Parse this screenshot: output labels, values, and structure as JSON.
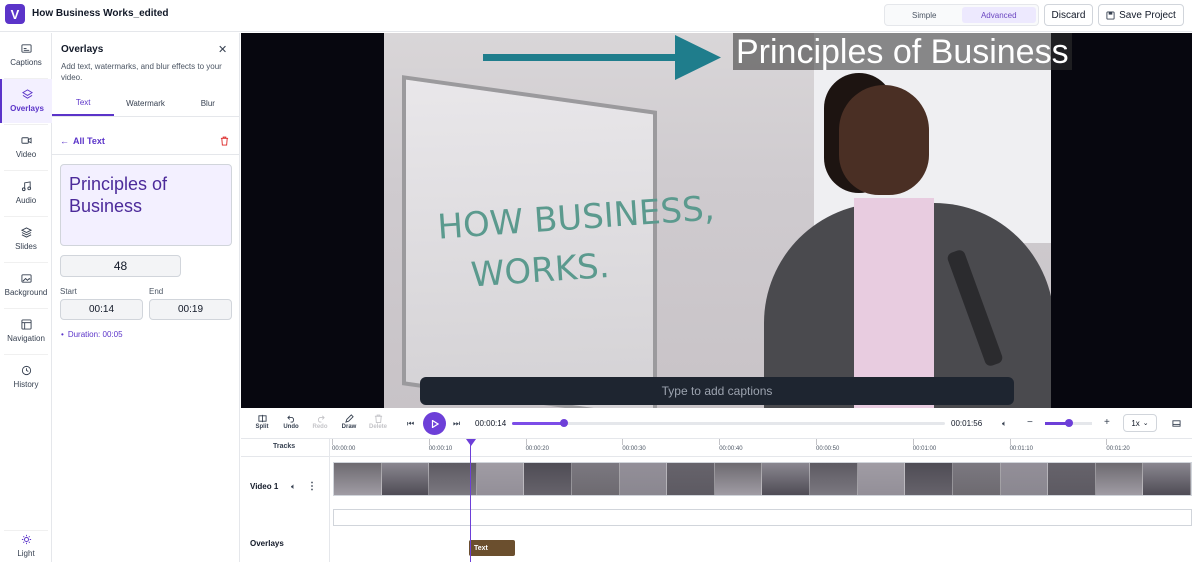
{
  "app": {
    "logo_letter": "V",
    "project_title": "How Business Works_edited",
    "mode_simple": "Simple",
    "mode_advanced": "Advanced",
    "discard_label": "Discard",
    "save_label": "Save Project"
  },
  "rail": {
    "items": [
      {
        "label": "Captions",
        "icon": "captions-icon"
      },
      {
        "label": "Overlays",
        "icon": "layers-icon"
      },
      {
        "label": "Video",
        "icon": "video-camera-icon"
      },
      {
        "label": "Audio",
        "icon": "music-note-icon"
      },
      {
        "label": "Slides",
        "icon": "stack-icon"
      },
      {
        "label": "Background",
        "icon": "image-icon"
      },
      {
        "label": "Navigation",
        "icon": "layout-icon"
      },
      {
        "label": "History",
        "icon": "history-icon"
      }
    ],
    "theme_label": "Light"
  },
  "panel": {
    "title": "Overlays",
    "description": "Add text, watermarks, and blur effects to your video.",
    "tabs": [
      "Text",
      "Watermark",
      "Blur"
    ],
    "active_tab": "Text",
    "back_label": "All Text",
    "text_value": "Principles of Business",
    "font_size": "48",
    "start_label": "Start",
    "end_label": "End",
    "start_value": "00:14",
    "end_value": "00:19",
    "duration": "Duration: 00:05"
  },
  "stage": {
    "overlay_text": "Principles of Business",
    "whiteboard_text_1": "HOW BUSINESS,",
    "whiteboard_text_2": "WORKS.",
    "caption_placeholder": "Type to add captions",
    "colors": {
      "accent": "#6d3fd8",
      "arrow": "#1f7d8c"
    }
  },
  "controls": {
    "tools": [
      "Split",
      "Undo",
      "Redo",
      "Draw",
      "Delete"
    ],
    "current_time": "00:00:14",
    "total_time": "00:01:56",
    "progress_fraction": 0.12,
    "zoom_fraction": 0.5,
    "speed": "1x"
  },
  "timeline": {
    "tracks_label": "Tracks",
    "ticks": [
      "00:00:00",
      "00:00:10",
      "00:00:20",
      "00:00:30",
      "00:00:40",
      "00:00:50",
      "00:01:00",
      "00:01:10",
      "00:01:20"
    ],
    "video_track_label": "Video 1",
    "overlays_track_label": "Overlays",
    "overlay_clip_label": "Text"
  }
}
